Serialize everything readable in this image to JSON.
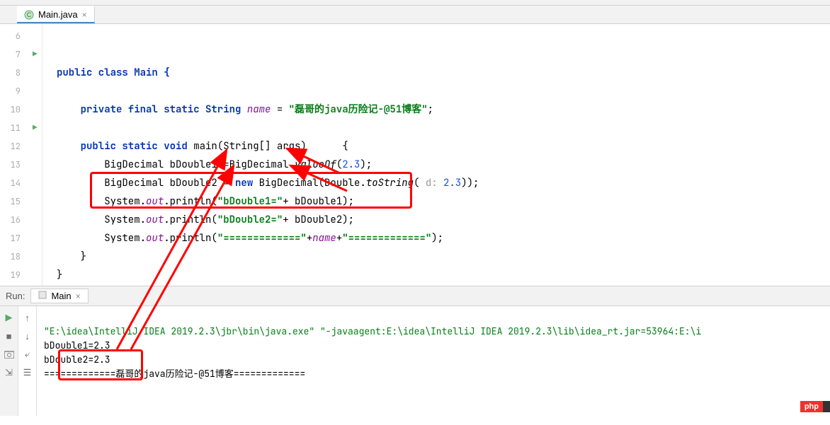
{
  "tab": {
    "filename": "Main.java"
  },
  "gutter_lines": [
    "6",
    "7",
    "8",
    "9",
    "10",
    "11",
    "12",
    "13",
    "14",
    "15",
    "16",
    "17",
    "18",
    "19"
  ],
  "code": {
    "class_decl": "public class Main {",
    "field_decl_pre": "private final static String ",
    "field_name": "name",
    "field_eq": " = ",
    "field_val": "\"磊哥的java历险记-@51博客\"",
    "main_sig_pre": "public static void ",
    "main_sig_name": "main",
    "main_sig_args": "(String[] args)      {",
    "l12_a": "BigDecimal bDouble1 =BigDecimal.",
    "l12_b": "valueOf",
    "l12_c": "(",
    "l12_num": "2.3",
    "l12_d": ");",
    "l13_a": "BigDecimal bDouble2 = ",
    "l13_new": "new ",
    "l13_b": "BigDecimal(Double.",
    "l13_c": "toString",
    "l13_d": "( ",
    "l13_hint": "d: ",
    "l13_num": "2.3",
    "l13_e": "));",
    "l14_a": "System.",
    "l14_out": "out",
    "l14_b": ".println(",
    "l14_str": "\"bDouble1=\"",
    "l14_c": "+ bDouble1);",
    "l15_a": "System.",
    "l15_out": "out",
    "l15_b": ".println(",
    "l15_str": "\"bDouble2=\"",
    "l15_c": "+ bDouble2);",
    "l16_a": "System.",
    "l16_out": "out",
    "l16_b": ".println(",
    "l16_str1": "\"=============\"",
    "l16_c": "+",
    "l16_name": "name",
    "l16_d": "+",
    "l16_str2": "\"=============\"",
    "l16_e": ");",
    "close1": "}",
    "close2": "}"
  },
  "run": {
    "label": "Run:",
    "config": "Main",
    "cmd": "\"E:\\idea\\IntelliJ IDEA 2019.2.3\\jbr\\bin\\java.exe\" \"-javaagent:E:\\idea\\IntelliJ IDEA 2019.2.3\\lib\\idea_rt.jar=53964:E:\\i",
    "out1": "bDouble1=2.3",
    "out2": "bDouble2=2.3",
    "out3": "=============磊哥的java历险记-@51博客============="
  },
  "watermark": "php"
}
